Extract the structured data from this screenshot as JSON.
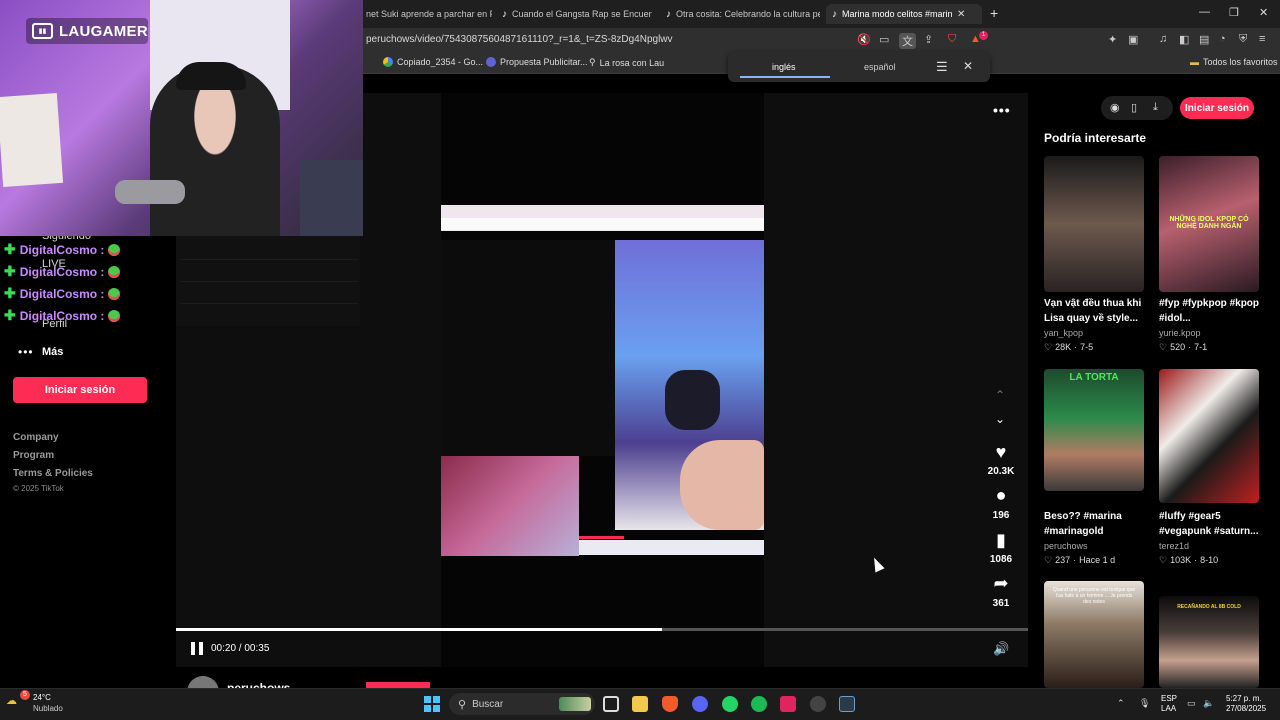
{
  "browser": {
    "tabs": [
      {
        "label": "net Suki aprende a parchar en Peru",
        "active": false
      },
      {
        "label": "Cuando el Gangsta Rap se Encuentra",
        "active": false
      },
      {
        "label": "Otra cosita: Celebrando la cultura pe",
        "active": false
      },
      {
        "label": "Marina modo celitos #marina",
        "active": true
      }
    ],
    "url": "peruchows/video/7543087560487161110?_r=1&_t=ZS-8zDg4Npglwv",
    "bookmarks": [
      "Copiado_2354 - Go...",
      "Propuesta Publicitar...",
      "La rosa con Lau"
    ],
    "all_bookmarks": "Todos los favoritos",
    "extension_badge": "1"
  },
  "translate_popup": {
    "source_lang": "inglés",
    "target_lang": "español"
  },
  "stream_overlay": {
    "channel_name": "LAUGAMER",
    "chat": [
      {
        "user": "DigitalCosmo :"
      },
      {
        "user": "DigitalCosmo :"
      },
      {
        "user": "DigitalCosmo :"
      },
      {
        "user": "DigitalCosmo :"
      }
    ]
  },
  "sidebar": {
    "ghost_items": [
      "Siguiendo",
      "LIVE",
      "Perfil"
    ],
    "more_label": "Más",
    "login_label": "Iniciar sesión",
    "footer_links": [
      "Company",
      "Program",
      "Terms & Policies"
    ],
    "copyright": "© 2025 TikTok"
  },
  "video": {
    "likes": "20.3K",
    "comments": "196",
    "saves": "1086",
    "shares": "361",
    "time": "00:20 / 00:35",
    "progress": 0.57,
    "author": "peruchows"
  },
  "header": {
    "login_label": "Iniciar sesión"
  },
  "recommendations": {
    "heading": "Podría interesarte",
    "items": [
      {
        "title": "Vạn vật đều thua khi Lisa quay về style...",
        "author": "yan_kpop",
        "likes": "28K",
        "date": "7-5",
        "thumb_text": ""
      },
      {
        "title": "#fyp #fypkpop #kpop #idol...",
        "author": "yurie.kpop",
        "likes": "520",
        "date": "7-1",
        "thumb_text": "NHỮNG IDOL KPOP CÓ NGHỆ DANH NGẮN"
      },
      {
        "title": "Beso?? #marina #marinagold",
        "author": "peruchows",
        "likes": "237",
        "date": "Hace 1 d",
        "thumb_text": "LA TORTA"
      },
      {
        "title": "#luffy #gear5 #vegapunk #saturn...",
        "author": "terez1d",
        "likes": "103K",
        "date": "8-10",
        "thumb_text": ""
      },
      {
        "title": "",
        "author": "",
        "likes": "",
        "date": "",
        "thumb_text": "Quand une personne est toxique que t'as faite à un homme ... Je prends des notes"
      },
      {
        "title": "",
        "author": "",
        "likes": "",
        "date": "",
        "thumb_text": "RECAÑANDO AL 8B COLD"
      }
    ]
  },
  "taskbar": {
    "weather_badge": "5",
    "temperature": "24°C",
    "weather": "Nublado",
    "search_placeholder": "Buscar",
    "lang_top": "ESP",
    "lang_bottom": "LAA",
    "time": "5:27 p. m.",
    "date": "27/08/2025"
  },
  "colors": {
    "accent": "#fe2c55",
    "chat_name": "#c98bff"
  }
}
